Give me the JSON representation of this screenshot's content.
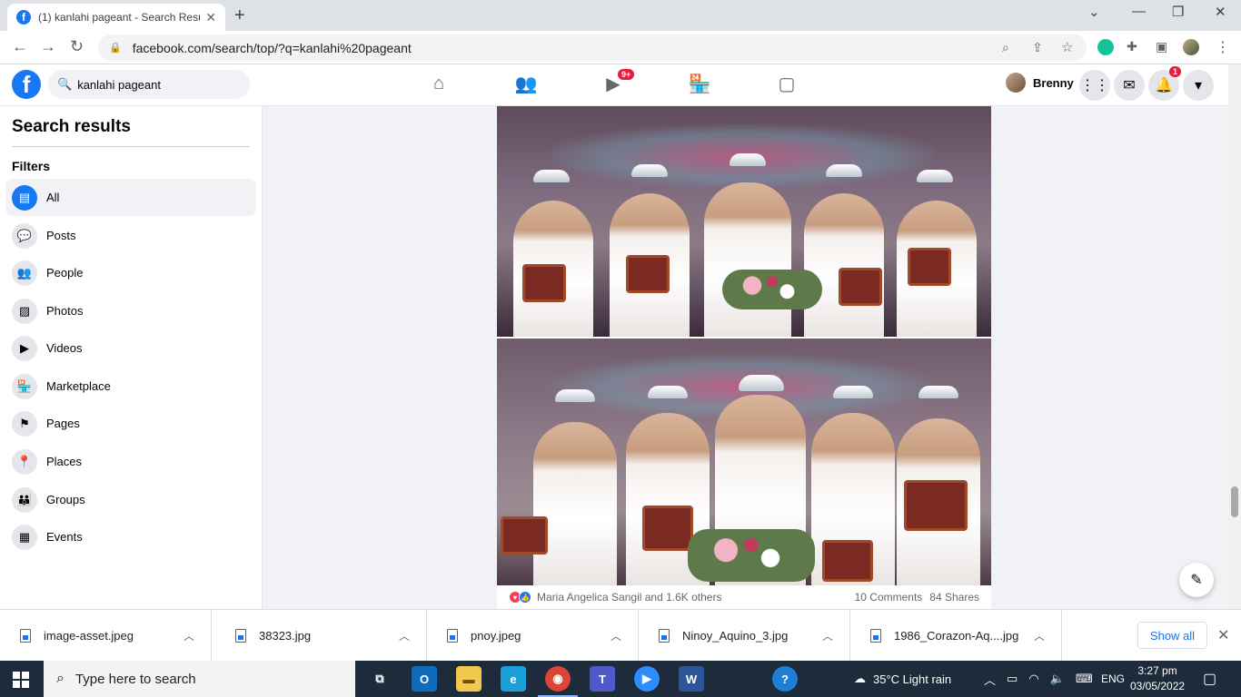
{
  "browser": {
    "tab_title": "(1) kanlahi pageant - Search Resu",
    "tab_favicon": "f",
    "url": "facebook.com/search/top/?q=kanlahi%20pageant"
  },
  "header": {
    "logo": "f",
    "search_value": "kanlahi pageant",
    "watch_badge": "9+",
    "profile_name": "Brenny",
    "notifications_badge": "1"
  },
  "sidebar": {
    "title": "Search results",
    "filters_label": "Filters",
    "items": [
      {
        "label": "All",
        "icon": "feed-icon"
      },
      {
        "label": "Posts",
        "icon": "comment-icon"
      },
      {
        "label": "People",
        "icon": "people-icon"
      },
      {
        "label": "Photos",
        "icon": "photo-icon"
      },
      {
        "label": "Videos",
        "icon": "video-icon"
      },
      {
        "label": "Marketplace",
        "icon": "store-icon"
      },
      {
        "label": "Pages",
        "icon": "flag-icon"
      },
      {
        "label": "Places",
        "icon": "pin-icon"
      },
      {
        "label": "Groups",
        "icon": "group-icon"
      },
      {
        "label": "Events",
        "icon": "calendar-icon"
      }
    ]
  },
  "post": {
    "reactions_text": "Maria Angelica Sangil and 1.6K others",
    "comments": "10 Comments",
    "shares": "84 Shares"
  },
  "downloads": {
    "items": [
      "image-asset.jpeg",
      "38323.jpg",
      "pnoy.jpeg",
      "Ninoy_Aquino_3.jpg",
      "1986_Corazon-Aq....jpg"
    ],
    "show_all": "Show all"
  },
  "taskbar": {
    "search_placeholder": "Type here to search",
    "weather": "35°C  Light rain",
    "language": "ENG",
    "time": "3:27 pm",
    "date": "03/05/2022"
  },
  "colors": {
    "fb_blue": "#1877f2",
    "badge_red": "#e41e3f"
  }
}
